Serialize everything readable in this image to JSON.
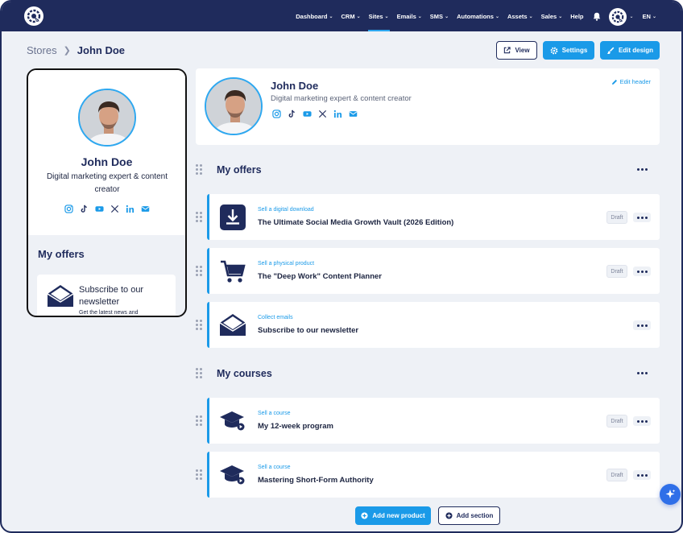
{
  "nav": {
    "items": [
      {
        "label": "Dashboard",
        "dropdown": true,
        "active": false
      },
      {
        "label": "CRM",
        "dropdown": true,
        "active": false
      },
      {
        "label": "Sites",
        "dropdown": true,
        "active": true
      },
      {
        "label": "Emails",
        "dropdown": true,
        "active": false
      },
      {
        "label": "SMS",
        "dropdown": true,
        "active": false
      },
      {
        "label": "Automations",
        "dropdown": true,
        "active": false
      },
      {
        "label": "Assets",
        "dropdown": true,
        "active": false
      },
      {
        "label": "Sales",
        "dropdown": true,
        "active": false
      },
      {
        "label": "Help",
        "dropdown": false,
        "active": false
      }
    ],
    "language": "EN"
  },
  "breadcrumb": {
    "parent": "Stores",
    "current": "John Doe"
  },
  "toolbar": {
    "view_label": "View",
    "settings_label": "Settings",
    "edit_design_label": "Edit design"
  },
  "profile": {
    "name": "John Doe",
    "bio_preview": "Digital marketing expert & content creator",
    "bio_header": "Digital marketing expert & content creator",
    "socials": [
      "instagram-icon",
      "tiktok-icon",
      "youtube-icon",
      "x-icon",
      "linkedin-icon",
      "mail-icon"
    ]
  },
  "preview": {
    "offers_title": "My offers",
    "offer_title": "Subscribe to our newsletter",
    "offer_desc": "Get the latest news and"
  },
  "header_card": {
    "edit_label": "Edit header"
  },
  "sections": [
    {
      "title": "My offers",
      "items": [
        {
          "type": "Sell a digital download",
          "title": "The Ultimate Social Media Growth Vault (2026 Edition)",
          "status": "Draft",
          "icon": "download-icon"
        },
        {
          "type": "Sell a physical product",
          "title": "The \"Deep Work\" Content Planner",
          "status": "Draft",
          "icon": "cart-icon"
        },
        {
          "type": "Collect emails",
          "title": "Subscribe to our newsletter",
          "status": "",
          "icon": "envelope-icon"
        }
      ]
    },
    {
      "title": "My courses",
      "items": [
        {
          "type": "Sell a course",
          "title": "My 12-week program",
          "status": "Draft",
          "icon": "graduation-cap-icon"
        },
        {
          "type": "Sell a course",
          "title": "Mastering Short-Form Authority",
          "status": "Draft",
          "icon": "graduation-cap-icon"
        }
      ]
    }
  ],
  "actions": {
    "add_product_label": "Add new product",
    "add_section_label": "Add section"
  },
  "colors": {
    "navy": "#1f2b5c",
    "accent": "#1a9ae8",
    "background": "#eef1f6"
  }
}
